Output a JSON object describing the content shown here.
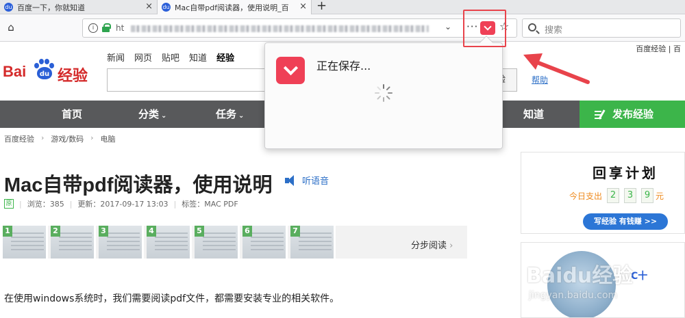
{
  "browser": {
    "tabs": [
      {
        "title": "百度一下，你就知道",
        "active": false
      },
      {
        "title": "Mac自带pdf阅读器，使用说明_百",
        "active": true
      }
    ],
    "new_tab_label": "+",
    "tab_close_glyph": "×",
    "url_prefix": "ht",
    "search_placeholder": "搜索",
    "page_actions_glyph": "···",
    "star_glyph": "☆",
    "home_glyph": "⌂",
    "dropdown_glyph": "⌄",
    "info_glyph": "i"
  },
  "pocket_popup": {
    "status": "正在保存..."
  },
  "page": {
    "top_links": "百度经验 | 百",
    "logo": {
      "left": "Bai",
      "paw": "du",
      "right": "经验"
    },
    "top_nav": [
      {
        "label": "新闻"
      },
      {
        "label": "网页"
      },
      {
        "label": "贴吧"
      },
      {
        "label": "知道"
      },
      {
        "label": "经验",
        "active": true
      }
    ],
    "search_button_label": "验",
    "help_link": "帮助",
    "main_nav": [
      {
        "label": "首页",
        "has_caret": false
      },
      {
        "label": "分类",
        "has_caret": true
      },
      {
        "label": "任务",
        "has_caret": true
      },
      {
        "label": "知道",
        "has_caret": false
      }
    ],
    "caret_glyph": "⌄",
    "publish_button": "发布经验",
    "breadcrumb": [
      "百度经验",
      "游戏/数码",
      "电脑"
    ],
    "breadcrumb_sep": "›",
    "article": {
      "title": "Mac自带pdf阅读器，使用说明",
      "listen_label": "听语音",
      "original_badge": "原",
      "views": "浏览：385",
      "updated": "更新：2017-09-17 13:03",
      "tags": "标签：MAC PDF",
      "meta_sep": "|",
      "steps": [
        "1",
        "2",
        "3",
        "4",
        "5",
        "6",
        "7"
      ],
      "step_read_label": "分步阅读",
      "step_read_glyph": "›",
      "body_first_line": "在使用windows系统时，我们需要阅读pdf文件，都需要安装专业的相关软件。"
    },
    "sidebar": {
      "ad_title": "回享计划",
      "ad_prefix": "今日支出",
      "ad_digits": [
        "2",
        "3",
        "9"
      ],
      "ad_unit": "元",
      "ad_button": "写经验 有钱赚 >>",
      "side_mark": "C十"
    },
    "watermark": {
      "line1": "Baidu经验",
      "line2": "jingyan.baidu.com"
    }
  },
  "colors": {
    "pocket_red": "#ef4056",
    "annotation_red": "#e8434b",
    "nav_gray": "#58595b",
    "publish_green": "#3cb54a",
    "baidu_red": "#d42a2a",
    "baidu_blue": "#2a5fd6",
    "link_blue": "#2c6fc7"
  },
  "icons": {
    "home": "home-icon",
    "info": "info-icon",
    "lock": "lock-icon",
    "pocket": "pocket-icon",
    "star": "star-icon",
    "search": "search-icon",
    "speaker": "speaker-icon",
    "spinner": "spinner-icon"
  }
}
